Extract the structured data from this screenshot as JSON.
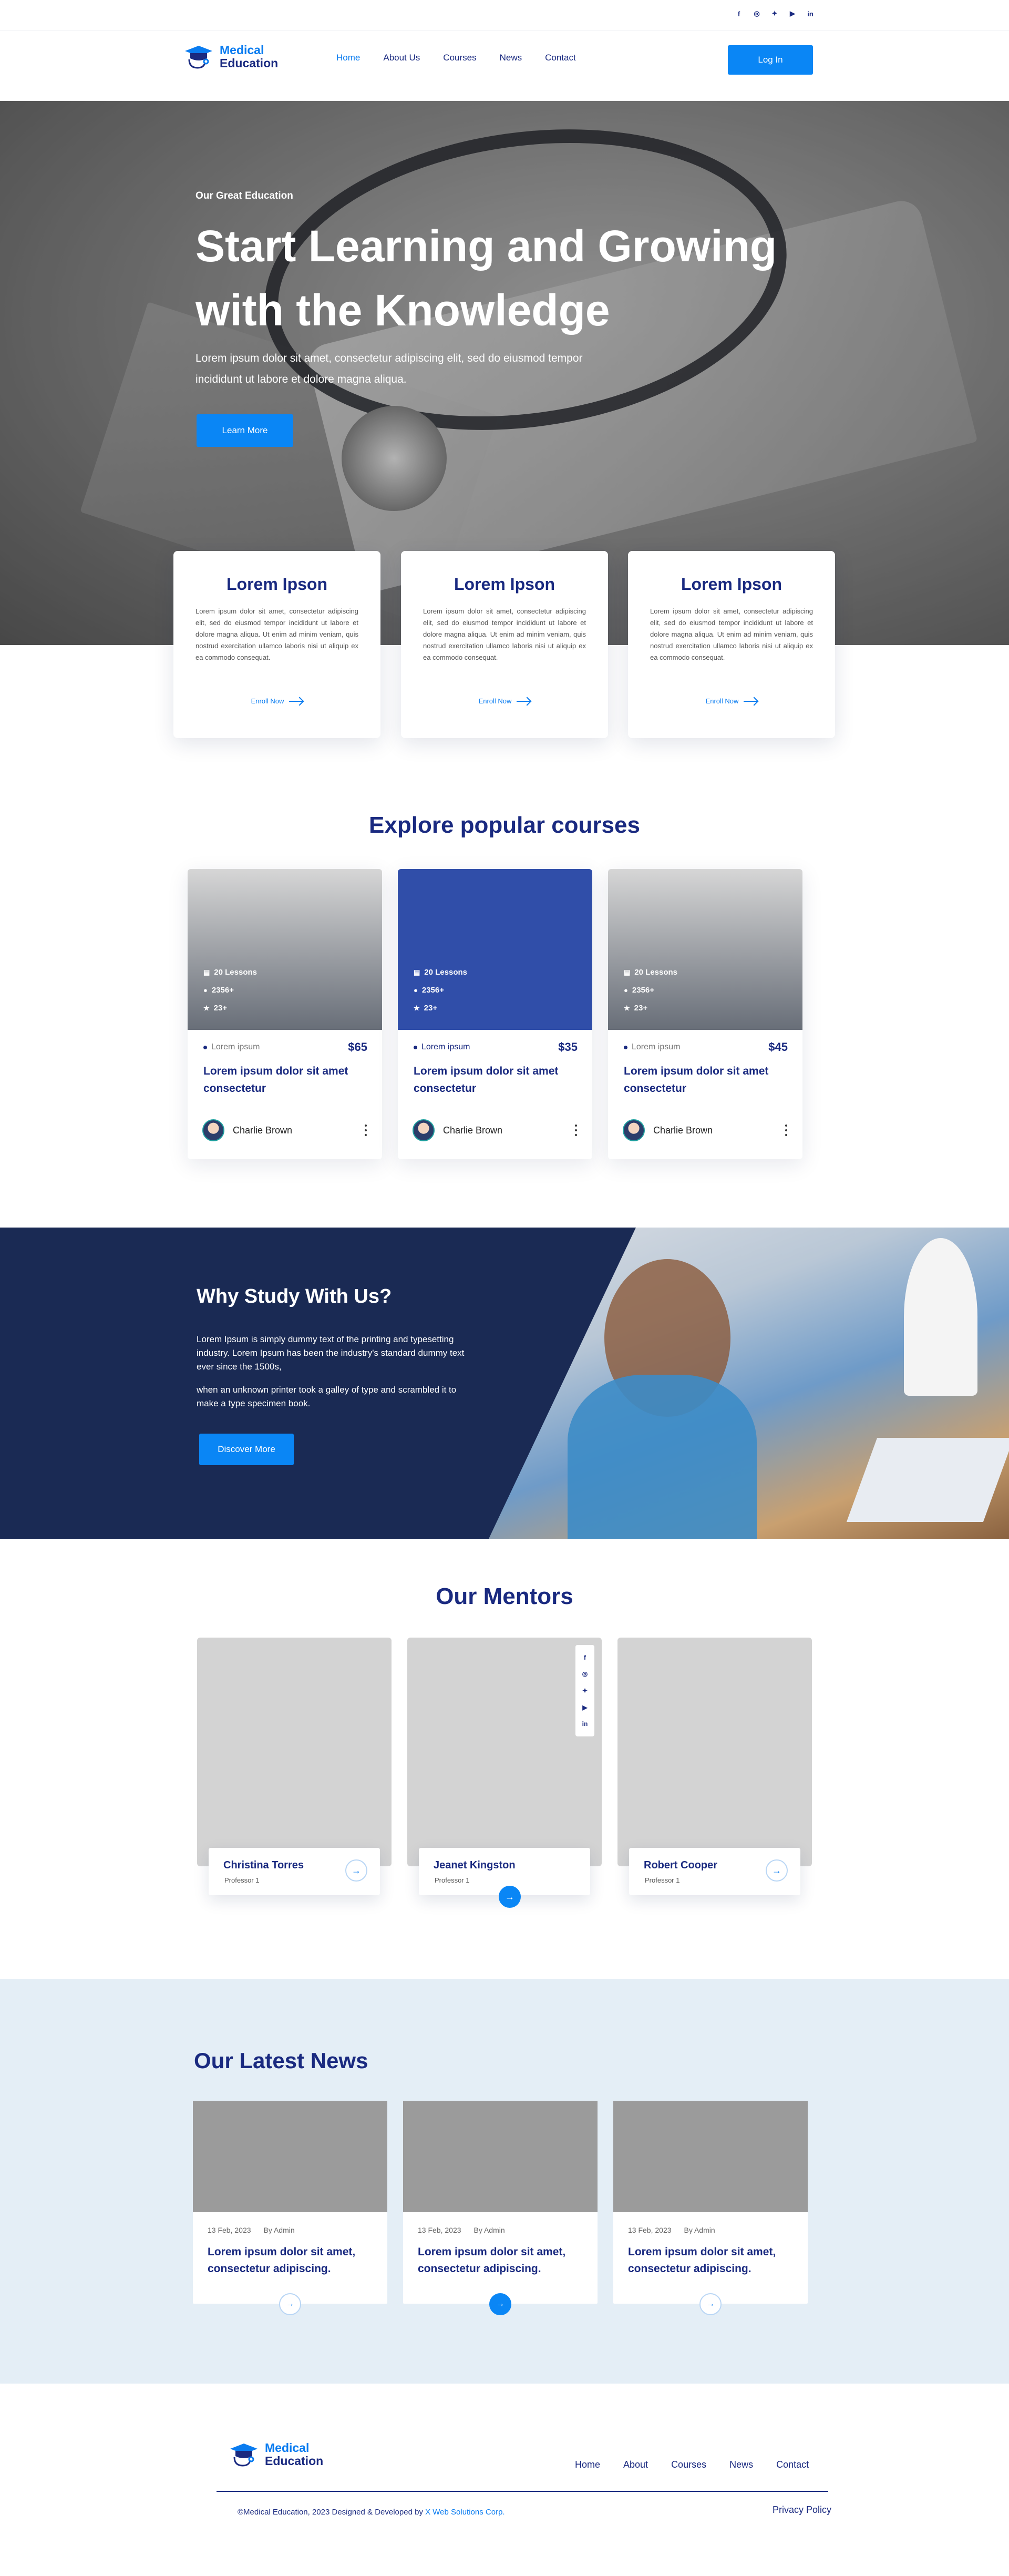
{
  "socials": [
    {
      "icon": "facebook-icon",
      "glyph": "f"
    },
    {
      "icon": "instagram-icon",
      "glyph": "◎"
    },
    {
      "icon": "twitter-icon",
      "glyph": "✦"
    },
    {
      "icon": "youtube-icon",
      "glyph": "▶"
    },
    {
      "icon": "linkedin-icon",
      "glyph": "in"
    }
  ],
  "brand": {
    "line1": "Medical",
    "line2": "Education",
    "accent": "#0a7cf0",
    "navy": "#1a2a80"
  },
  "nav": {
    "home": "Home",
    "about": "About Us",
    "courses": "Courses",
    "news": "News",
    "contact": "Contact",
    "login": "Log In"
  },
  "hero": {
    "kicker": "Our Great Education",
    "title": "Start Learning and Growing with the Knowledge",
    "subtitle": "Lorem ipsum dolor sit amet, consectetur adipiscing elit, sed do eiusmod tempor incididunt ut labore et dolore magna aliqua.",
    "button": "Learn More"
  },
  "features": [
    {
      "title": "Lorem Ipson",
      "text": "Lorem ipsum dolor sit amet, consectetur adipiscing elit, sed do eiusmod tempor incididunt ut labore et dolore magna aliqua. Ut enim ad minim veniam, quis nostrud exercitation ullamco laboris nisi ut aliquip ex ea commodo consequat.",
      "link": "Enroll Now"
    },
    {
      "title": "Lorem Ipson",
      "text": "Lorem ipsum dolor sit amet, consectetur adipiscing elit, sed do eiusmod tempor incididunt ut labore et dolore magna aliqua. Ut enim ad minim veniam, quis nostrud exercitation ullamco laboris nisi ut aliquip ex ea commodo consequat.",
      "link": "Enroll Now"
    },
    {
      "title": "Lorem Ipson",
      "text": "Lorem ipsum dolor sit amet, consectetur adipiscing elit, sed do eiusmod tempor incididunt ut labore et dolore magna aliqua. Ut enim ad minim veniam, quis nostrud exercitation ullamco laboris nisi ut aliquip ex ea commodo consequat.",
      "link": "Enroll Now"
    }
  ],
  "courses_title": "Explore popular courses",
  "courses": [
    {
      "lessons": "20 Lessons",
      "students": "2356+",
      "rating": "23+",
      "category": "Lorem ipsum",
      "price": "$65",
      "title": "Lorem ipsum dolor sit amet consectetur",
      "author": "Charlie Brown"
    },
    {
      "lessons": "20 Lessons",
      "students": "2356+",
      "rating": "23+",
      "category": "Lorem ipsum",
      "price": "$35",
      "title": "Lorem ipsum dolor sit amet consectetur",
      "author": "Charlie Brown"
    },
    {
      "lessons": "20 Lessons",
      "students": "2356+",
      "rating": "23+",
      "category": "Lorem ipsum",
      "price": "$45",
      "title": "Lorem ipsum dolor sit amet consectetur",
      "author": "Charlie Brown"
    }
  ],
  "why": {
    "title": "Why Study With Us?",
    "p1": "Lorem Ipsum is simply dummy text of the printing and typesetting industry. Lorem Ipsum has been the industry's standard dummy text ever since the 1500s,",
    "p2": "when an unknown printer took a galley of type and scrambled it to make a type specimen book.",
    "button": "Discover More"
  },
  "mentors_title": "Our Mentors",
  "mentors": [
    {
      "name": "Christina Torres",
      "role": "Professor 1"
    },
    {
      "name": "Jeanet Kingston",
      "role": "Professor 1"
    },
    {
      "name": "Robert Cooper",
      "role": "Professor 1"
    }
  ],
  "news_title": "Our Latest News",
  "news": [
    {
      "date": "13 Feb, 2023",
      "by": "By Admin",
      "title": "Lorem ipsum dolor sit amet, consectetur adipiscing."
    },
    {
      "date": "13 Feb, 2023",
      "by": "By Admin",
      "title": "Lorem ipsum dolor sit amet, consectetur adipiscing."
    },
    {
      "date": "13 Feb, 2023",
      "by": "By Admin",
      "title": "Lorem ipsum dolor sit amet, consectetur adipiscing."
    }
  ],
  "footer": {
    "nav": {
      "home": "Home",
      "about": "About",
      "courses": "Courses",
      "news": "News",
      "contact": "Contact"
    },
    "copy_prefix": "©Medical Education, 2023 Designed & Developed by",
    "copy_company": "X Web Solutions Corp.",
    "privacy": "Privacy Policy"
  }
}
